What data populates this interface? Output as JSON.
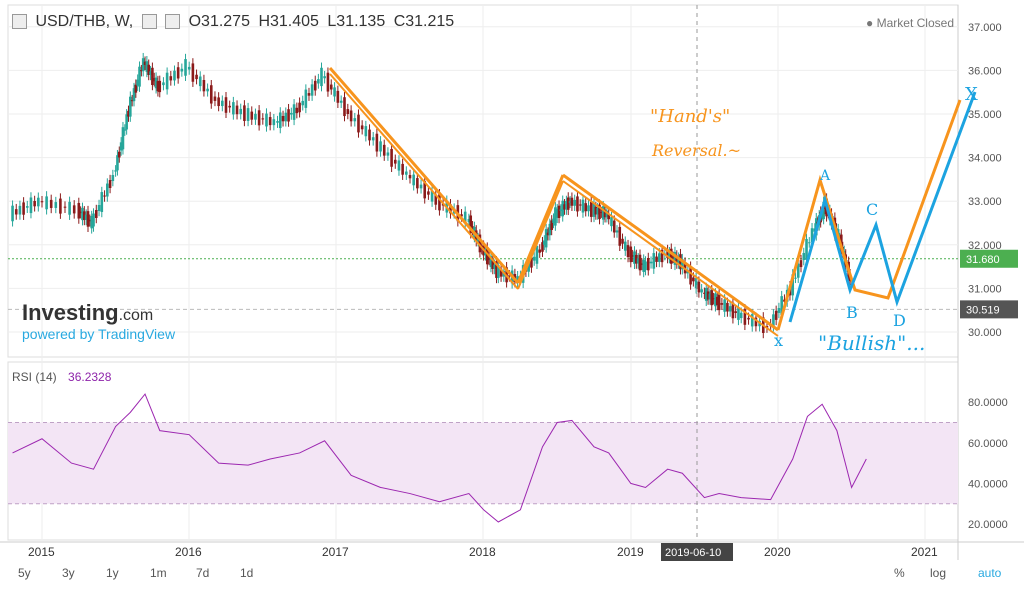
{
  "header": {
    "symbol": "USD/THB, W,",
    "open": "O31.275",
    "high": "H31.405",
    "low": "L31.135",
    "close": "C31.215",
    "market_status": "Market Closed"
  },
  "rsi": {
    "label": "RSI (14)",
    "value": "36.2328"
  },
  "branding": {
    "name": "Investing",
    "suffix": ".com",
    "powered": "powered by TradingView"
  },
  "price_markers": {
    "current": "31.680",
    "dashed": "30.519"
  },
  "crosshair_date": "2019-06-10",
  "timeframes": [
    "5y",
    "3y",
    "1y",
    "1m",
    "7d",
    "1d"
  ],
  "scale_buttons": [
    "%",
    "log",
    "auto"
  ],
  "annotations": {
    "note1": "\"Hand's\"",
    "note2": "Reversal.~",
    "bullish": "\"Bullish\"...",
    "X1": "x",
    "A": "A",
    "B": "B",
    "C": "C",
    "D": "D",
    "X2": "X"
  },
  "colors": {
    "up": "#26a69a",
    "down": "#8b1a1a",
    "rsi": "#9c27b0",
    "orange": "#f7941d",
    "blue": "#1ca3e0",
    "green_line": "#4caf50"
  },
  "chart_data": [
    {
      "type": "candlestick",
      "title": "USD/THB, W,",
      "x": [
        "2015",
        "2016",
        "2017",
        "2018",
        "2019",
        "2020",
        "2021"
      ],
      "ylim": [
        29.6,
        37.2
      ],
      "yticks": [
        "30.000",
        "31.000",
        "32.000",
        "33.000",
        "34.000",
        "35.000",
        "36.000",
        "37.000"
      ],
      "series": [
        {
          "values": [
            [
              2014.8,
              32.7
            ],
            [
              2015.0,
              33.0
            ],
            [
              2015.25,
              32.8
            ],
            [
              2015.35,
              32.5
            ],
            [
              2015.5,
              33.6
            ],
            [
              2015.6,
              35.1
            ],
            [
              2015.7,
              36.2
            ],
            [
              2015.8,
              35.6
            ],
            [
              2016.0,
              36.1
            ],
            [
              2016.2,
              35.3
            ],
            [
              2016.4,
              35.0
            ],
            [
              2016.6,
              34.8
            ],
            [
              2016.75,
              35.1
            ],
            [
              2016.92,
              35.9
            ],
            [
              2017.1,
              35.0
            ],
            [
              2017.3,
              34.3
            ],
            [
              2017.5,
              33.6
            ],
            [
              2017.7,
              33.0
            ],
            [
              2017.9,
              32.6
            ],
            [
              2018.0,
              31.9
            ],
            [
              2018.1,
              31.4
            ],
            [
              2018.25,
              31.2
            ],
            [
              2018.4,
              31.9
            ],
            [
              2018.5,
              32.7
            ],
            [
              2018.6,
              33.0
            ],
            [
              2018.75,
              32.8
            ],
            [
              2018.85,
              32.7
            ],
            [
              2019.0,
              31.8
            ],
            [
              2019.1,
              31.5
            ],
            [
              2019.25,
              31.8
            ],
            [
              2019.35,
              31.6
            ],
            [
              2019.5,
              30.9
            ],
            [
              2019.6,
              30.7
            ],
            [
              2019.75,
              30.4
            ],
            [
              2019.95,
              30.1
            ],
            [
              2020.1,
              31.0
            ],
            [
              2020.25,
              32.3
            ],
            [
              2020.33,
              32.9
            ],
            [
              2020.42,
              32.2
            ],
            [
              2020.5,
              31.2
            ]
          ]
        }
      ]
    },
    {
      "type": "line",
      "title": "RSI (14)",
      "ylim": [
        15,
        85
      ],
      "yticks": [
        "20.0000",
        "40.0000",
        "60.0000",
        "80.0000"
      ],
      "values": [
        [
          2014.8,
          55
        ],
        [
          2015.0,
          62
        ],
        [
          2015.2,
          50
        ],
        [
          2015.35,
          47
        ],
        [
          2015.5,
          68
        ],
        [
          2015.6,
          75
        ],
        [
          2015.7,
          84
        ],
        [
          2015.8,
          66
        ],
        [
          2016.0,
          64
        ],
        [
          2016.2,
          50
        ],
        [
          2016.4,
          49
        ],
        [
          2016.55,
          52
        ],
        [
          2016.75,
          55
        ],
        [
          2016.92,
          61
        ],
        [
          2017.1,
          44
        ],
        [
          2017.3,
          38
        ],
        [
          2017.5,
          35
        ],
        [
          2017.7,
          31
        ],
        [
          2017.9,
          35
        ],
        [
          2018.0,
          27
        ],
        [
          2018.1,
          21
        ],
        [
          2018.25,
          27
        ],
        [
          2018.4,
          58
        ],
        [
          2018.5,
          70
        ],
        [
          2018.6,
          71
        ],
        [
          2018.75,
          58
        ],
        [
          2018.85,
          55
        ],
        [
          2019.0,
          40
        ],
        [
          2019.1,
          38
        ],
        [
          2019.25,
          47
        ],
        [
          2019.35,
          45
        ],
        [
          2019.5,
          33
        ],
        [
          2019.6,
          35
        ],
        [
          2019.75,
          33
        ],
        [
          2019.95,
          32
        ],
        [
          2020.1,
          52
        ],
        [
          2020.2,
          73
        ],
        [
          2020.3,
          79
        ],
        [
          2020.4,
          66
        ],
        [
          2020.5,
          38
        ],
        [
          2020.6,
          52
        ]
      ]
    }
  ]
}
